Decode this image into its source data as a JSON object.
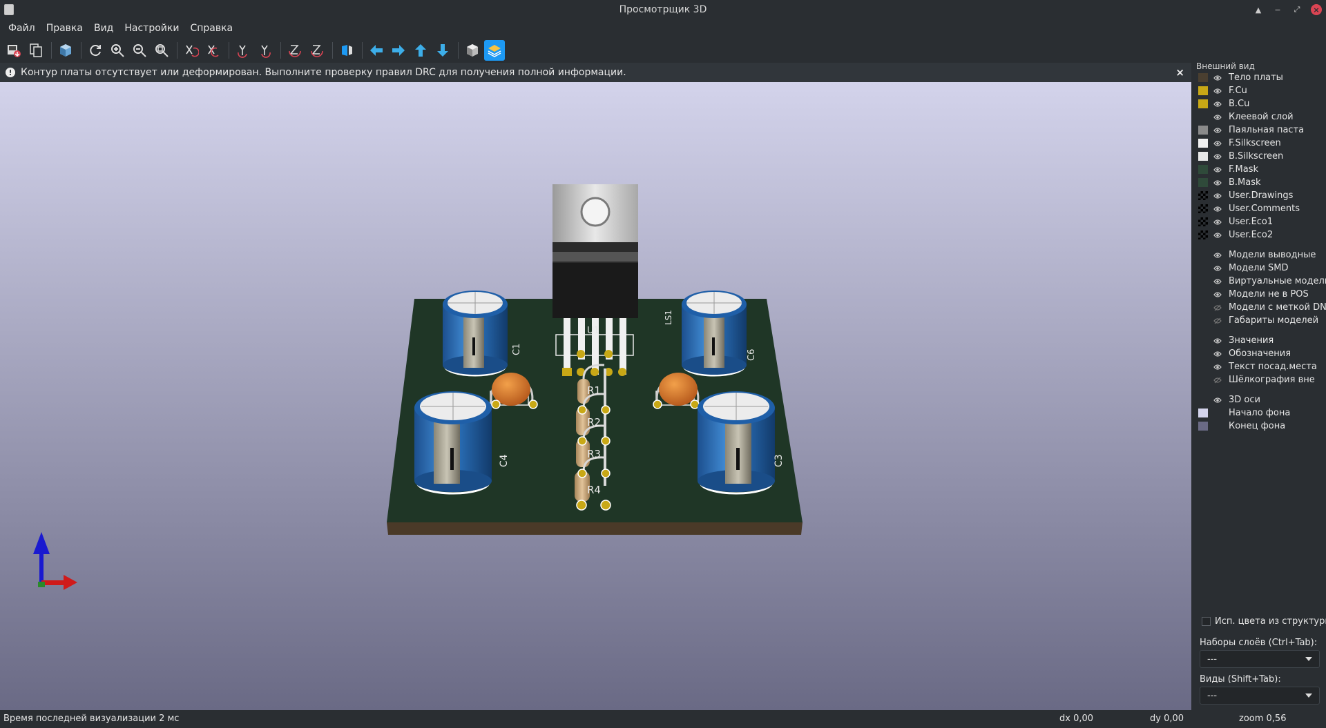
{
  "window": {
    "title": "Просмотрщик 3D"
  },
  "menu": [
    "Файл",
    "Правка",
    "Вид",
    "Настройки",
    "Справка"
  ],
  "infobar": {
    "message": "Контур платы отсутствует или деформирован. Выполните проверку правил DRC для получения полной информации.",
    "icon": "!",
    "close": "×"
  },
  "board": {
    "designators": {
      "u1": "U1",
      "ls1": "LS1",
      "c1": "C1",
      "c6": "C6",
      "c4": "C4",
      "c3": "C3",
      "r1": "R1",
      "r2": "R2",
      "r3": "R3",
      "r4": "R4"
    }
  },
  "panel": {
    "title": "Внешний вид",
    "layers": [
      {
        "label": "Тело платы",
        "color": "#4a3f30",
        "icon": "eye-icon"
      },
      {
        "label": "F.Cu",
        "color": "#c8a816",
        "icon": "eye-icon"
      },
      {
        "label": "B.Cu",
        "color": "#c8a816",
        "icon": "eye-icon"
      },
      {
        "label": "Клеевой слой",
        "color": "",
        "icon": "eye-icon"
      },
      {
        "label": "Паяльная паста",
        "color": "#8a8a8a",
        "icon": "eye-icon"
      },
      {
        "label": "F.Silkscreen",
        "color": "#f0f0f0",
        "icon": "eye-icon"
      },
      {
        "label": "B.Silkscreen",
        "color": "#e8e8e8",
        "icon": "eye-icon"
      },
      {
        "label": "F.Mask",
        "color": "#2f4a3a",
        "icon": "eye-icon"
      },
      {
        "label": "B.Mask",
        "color": "#2f4a3a",
        "icon": "eye-icon"
      },
      {
        "label": "User.Drawings",
        "color": "checker",
        "icon": "eye-icon"
      },
      {
        "label": "User.Comments",
        "color": "checker",
        "icon": "eye-icon"
      },
      {
        "label": "User.Eco1",
        "color": "checker",
        "icon": "eye-icon"
      },
      {
        "label": "User.Eco2",
        "color": "checker",
        "icon": "eye-icon"
      }
    ],
    "models": [
      {
        "label": "Модели выводные",
        "icon": "eye-icon"
      },
      {
        "label": "Модели SMD",
        "icon": "eye-icon"
      },
      {
        "label": "Виртуальные модели",
        "icon": "eye-icon"
      },
      {
        "label": "Модели не в POS",
        "icon": "eye-icon"
      },
      {
        "label": "Модели с меткой DNP",
        "icon": "eye-off-icon"
      },
      {
        "label": "Габариты моделей",
        "icon": "eye-off-icon"
      }
    ],
    "text_items": [
      {
        "label": "Значения",
        "icon": "eye-icon"
      },
      {
        "label": "Обозначения",
        "icon": "eye-icon"
      },
      {
        "label": "Текст посад.места",
        "icon": "eye-icon"
      },
      {
        "label": "Шёлкография вне",
        "icon": "eye-off-icon"
      }
    ],
    "other": [
      {
        "label": "3D оси",
        "color": "",
        "icon": "eye-icon"
      },
      {
        "label": "Начало фона",
        "color": "#d3d3eb",
        "icon": ""
      },
      {
        "label": "Конец фона",
        "color": "#6a6a85",
        "icon": ""
      }
    ],
    "checkbox_label": "Исп. цвета из структуры пл",
    "layer_presets_label": "Наборы слоёв (Ctrl+Tab):",
    "layer_presets_value": "---",
    "viewports_label": "Виды (Shift+Tab):",
    "viewports_value": "---"
  },
  "status": {
    "render_time": "Время последней визуализации 2 мс",
    "dx": "dx 0,00",
    "dy": "dy 0,00",
    "zoom": "zoom 0,56"
  }
}
